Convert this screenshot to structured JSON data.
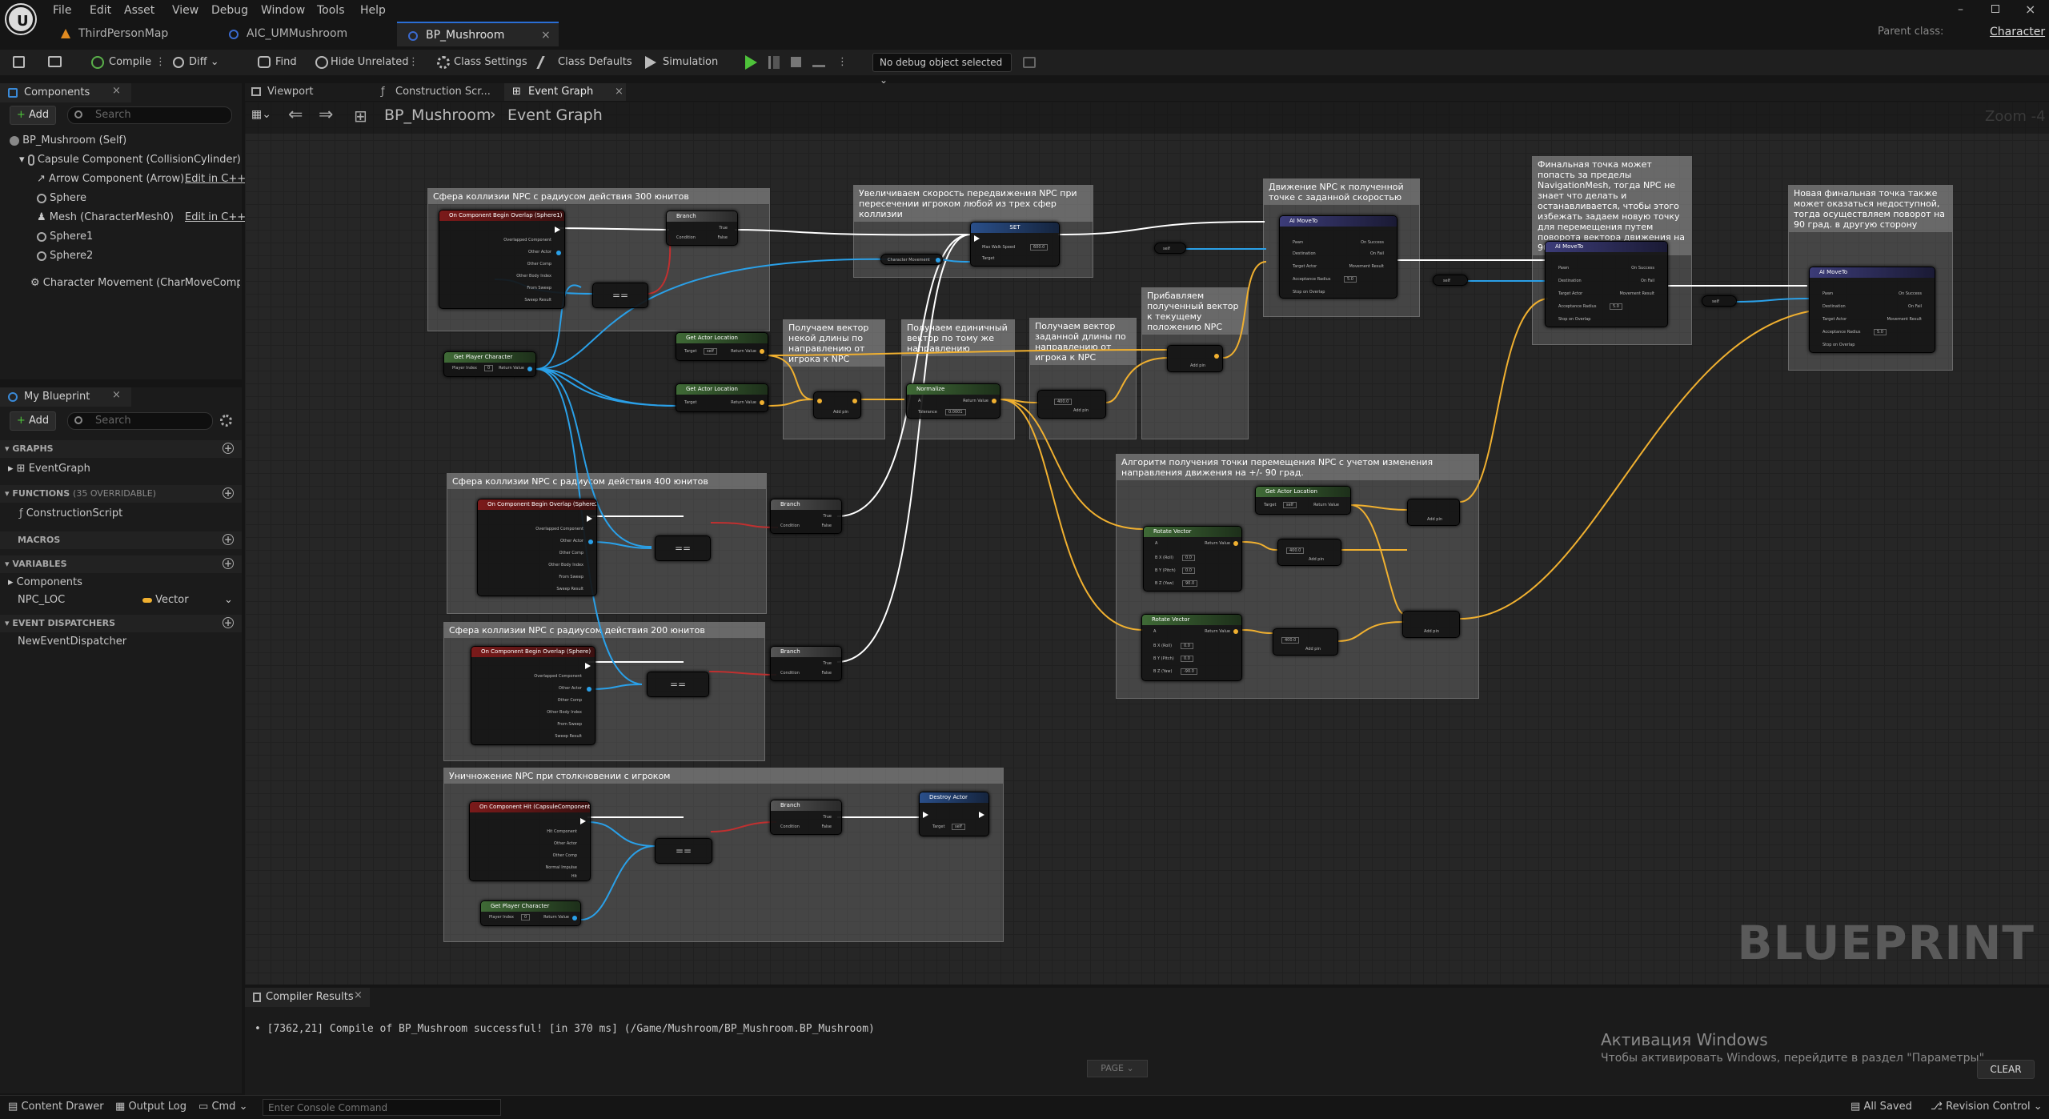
{
  "menu": [
    "File",
    "Edit",
    "Asset",
    "View",
    "Debug",
    "Window",
    "Tools",
    "Help"
  ],
  "tabs": [
    "ThirdPersonMap",
    "AIC_UMMushroom",
    "BP_Mushroom"
  ],
  "parent_class_label": "Parent class:",
  "parent_class_value": "Character",
  "toolbar": {
    "compile": "Compile",
    "diff": "Diff",
    "find": "Find",
    "hide_unrelated": "Hide Unrelated",
    "class_settings": "Class Settings",
    "class_defaults": "Class Defaults",
    "simulation": "Simulation",
    "debug_select": "No debug object selected"
  },
  "components": {
    "tab": "Components",
    "add": "Add",
    "search": "Search",
    "tree": [
      {
        "label": "BP_Mushroom (Self)",
        "extra": ""
      },
      {
        "label": "Capsule Component (CollisionCylinder)",
        "extra": "E"
      },
      {
        "label": "Arrow Component (Arrow)",
        "extra": "Edit in C++"
      },
      {
        "label": "Sphere",
        "extra": ""
      },
      {
        "label": "Mesh (CharacterMesh0)",
        "extra": "Edit in C++"
      },
      {
        "label": "Sphere1",
        "extra": ""
      },
      {
        "label": "Sphere2",
        "extra": ""
      },
      {
        "label": "Character Movement (CharMoveComp)",
        "extra": "E"
      }
    ]
  },
  "myblueprint": {
    "tab": "My Blueprint",
    "add": "Add",
    "search": "Search",
    "graphs": "GRAPHS",
    "eventgraph": "EventGraph",
    "functions": "FUNCTIONS",
    "functions_count": "(35 OVERRIDABLE)",
    "construction": "ConstructionScript",
    "macros": "MACROS",
    "variables": "VARIABLES",
    "components": "Components",
    "var_name": "NPC_LOC",
    "var_type": "Vector",
    "dispatchers": "EVENT DISPATCHERS",
    "dispatcher": "NewEventDispatcher"
  },
  "editor_tabs": [
    "Viewport",
    "Construction Scr...",
    "Event Graph"
  ],
  "breadcrumb": {
    "bp": "BP_Mushroom",
    "graph": "Event Graph"
  },
  "zoom": "Zoom -4",
  "watermark": "BLUEPRINT",
  "comments": [
    "Сфера коллизии NPC с радиусом действия 300 юнитов",
    "Увеличиваем скорость передвижения NPC при пересечении игроком любой из трех сфер коллизии",
    "Движение NPC к полученной точке с заданной скоростью",
    "Финальная точка может попасть за пределы NavigationMesh, тогда NPC не знает что делать и останавливается, чтобы этого избежать задаем новую точку для перемещения путем поворота вектора движения на 90 град.",
    "Новая финальная точка также может оказаться недоступной, тогда осуществляем поворот на 90 град. в другую сторону",
    "Получаем вектор некой длины по направлению от игрока к NPC",
    "Получаем единичный вектор по тому же направлению",
    "Получаем вектор заданной длины по направлению от игрока к NPC",
    "Прибавляем полученный вектор к текущему положению NPC",
    "Алгоритм получения точки перемещения NPC с учетом изменения направления движения на +/- 90 град.",
    "Сфера коллизии NPC с радиусом действия 400 юнитов",
    "Сфера коллизии NPC с радиусом действия 200 юнитов",
    "Уничножение NPC при столкновении с игроком"
  ],
  "nodes": {
    "overlap1": "On Component Begin Overlap (Sphere1)",
    "overlap2": "On Component Begin Overlap (Sphere2)",
    "overlap3": "On Component Begin Overlap (Sphere)",
    "hit": "On Component Hit (CapsuleComponent)",
    "branch": "Branch",
    "equal": "==",
    "getplayer": "Get Player Character",
    "actorloc": "Get Actor Location",
    "set": "SET",
    "moveto": "AI MoveTo",
    "normalize": "Normalize",
    "rotate": "Rotate Vector",
    "destroy": "Destroy Actor",
    "addpin": "Add pin",
    "true": "True",
    "false": "False",
    "condition": "Condition",
    "target": "Target",
    "self": "self",
    "return": "Return Value",
    "index": "Player Index",
    "maxwalk": "Max Walk Speed",
    "charmove": "Character Movement",
    "pawn": "Pawn",
    "dest": "Destination",
    "targetactor": "Target Actor",
    "radius": "Acceptance Radius",
    "stop": "Stop on Overlap",
    "onsuccess": "On Success",
    "onfail": "On Fail",
    "moveresult": "Movement Result",
    "overlapped": "Overlapped Component",
    "otheractor": "Other Actor",
    "othercomp": "Other Comp",
    "otherbody": "Other Body Index",
    "fromsweep": "From Sweep",
    "sweepresult": "Sweep Result",
    "hitcomp": "Hit Component",
    "normalimpulse": "Normal Impulse",
    "hit_pin": "Hit",
    "tolerance": "Tolerance",
    "a": "A",
    "bx": "B X (Roll)",
    "by": "B Y (Pitch)",
    "bz": "B Z (Yaw)",
    "speed": "600.0",
    "tol": "0.0001",
    "len": "400.0",
    "rad": "5.0",
    "ang1": "90.0",
    "ang2": "-90.0",
    "zero": "0.0",
    "idx": "0"
  },
  "compiler": {
    "tab": "Compiler Results",
    "msg": "[7362,21] Compile of BP_Mushroom successful! [in 370 ms] (/Game/Mushroom/BP_Mushroom.BP_Mushroom)",
    "page": "PAGE",
    "clear": "CLEAR"
  },
  "activation": {
    "title": "Активация Windows",
    "sub": "Чтобы активировать Windows, перейдите в раздел \"Параметры\"."
  },
  "status": {
    "content_drawer": "Content Drawer",
    "output_log": "Output Log",
    "cmd": "Cmd",
    "console_placeholder": "Enter Console Command",
    "saved": "All Saved",
    "revision": "Revision Control"
  }
}
